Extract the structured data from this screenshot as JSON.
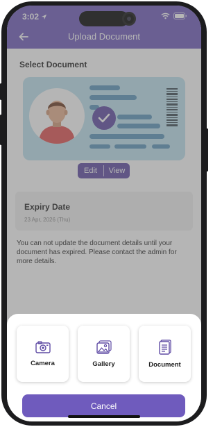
{
  "status": {
    "time": "3:02"
  },
  "header": {
    "title": "Upload Document"
  },
  "section": {
    "title": "Select Document"
  },
  "document_actions": {
    "edit_label": "Edit",
    "view_label": "View"
  },
  "expiry": {
    "label": "Expiry Date",
    "date": "23 Apr, 2026 (Thu)"
  },
  "notice": "You can not  update the document details until your document has expired. Please contact the admin for more details.",
  "sheet": {
    "options": [
      {
        "label": "Camera",
        "icon": "camera-icon"
      },
      {
        "label": "Gallery",
        "icon": "gallery-icon"
      },
      {
        "label": "Document",
        "icon": "document-icon"
      }
    ],
    "cancel_label": "Cancel"
  },
  "colors": {
    "primary": "#6f5bbd",
    "card": "#bfe3ef",
    "badge": "#5e4aa4"
  }
}
